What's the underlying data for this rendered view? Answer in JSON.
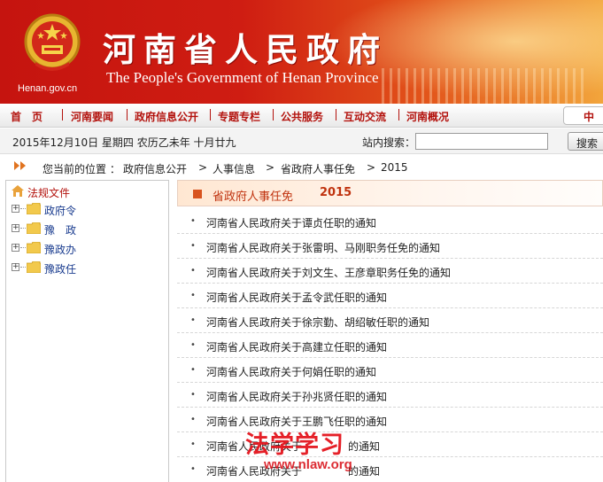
{
  "header": {
    "title": "河南省人民政府",
    "subtitle": "The People's Government of Henan Province",
    "domain": "Henan.gov.cn"
  },
  "nav": {
    "items": [
      "首　页",
      "河南要闻",
      "政府信息公开",
      "专题专栏",
      "公共服务",
      "互动交流",
      "河南概况"
    ],
    "lang_tab": "中"
  },
  "info": {
    "date": "2015年12月10日  星期四  农历乙未年  十月廿九",
    "search_label": "站内搜索：",
    "search_value": "",
    "search_button": "搜索"
  },
  "breadcrumb": {
    "prefix": "您当前的位置 ：",
    "items": [
      "政府信息公开",
      "人事信息",
      "省政府人事任免",
      "2015"
    ],
    "separator": ">"
  },
  "sidebar": {
    "root_label": "法规文件",
    "items": [
      "政府令",
      "豫　政",
      "豫政办",
      "豫政任"
    ]
  },
  "content": {
    "heading": "省政府人事任免",
    "year": "2015",
    "articles": [
      "河南省人民政府关于谭贞任职的通知",
      "河南省人民政府关于张雷明、马刚职务任免的通知",
      "河南省人民政府关于刘文生、王彦章职务任免的通知",
      "河南省人民政府关于孟令武任职的通知",
      "河南省人民政府关于徐宗勤、胡绍敏任职的通知",
      "河南省人民政府关于高建立任职的通知",
      "河南省人民政府关于何娟任职的通知",
      "河南省人民政府关于孙兆贤任职的通知",
      "河南省人民政府关于王鹏飞任职的通知",
      "河南省人民政府关于",
      "河南省人民政府关于"
    ],
    "articles_tail": [
      "",
      "",
      "",
      "",
      "",
      "",
      "",
      "",
      "",
      "的通知",
      "的通知"
    ]
  },
  "watermark": {
    "text": "法学学习",
    "url": "www.nlaw.org"
  },
  "colors": {
    "brand_red": "#c5140f",
    "nav_red": "#b3120d",
    "accent_orange": "#d8531e",
    "link_blue": "#1a3c8f"
  },
  "icons": {
    "emblem": "national-emblem-icon",
    "breadcrumb": "double-arrow-icon",
    "sidebar_root": "home-icon",
    "folder": "folder-icon",
    "expand": "plus-box-icon"
  }
}
